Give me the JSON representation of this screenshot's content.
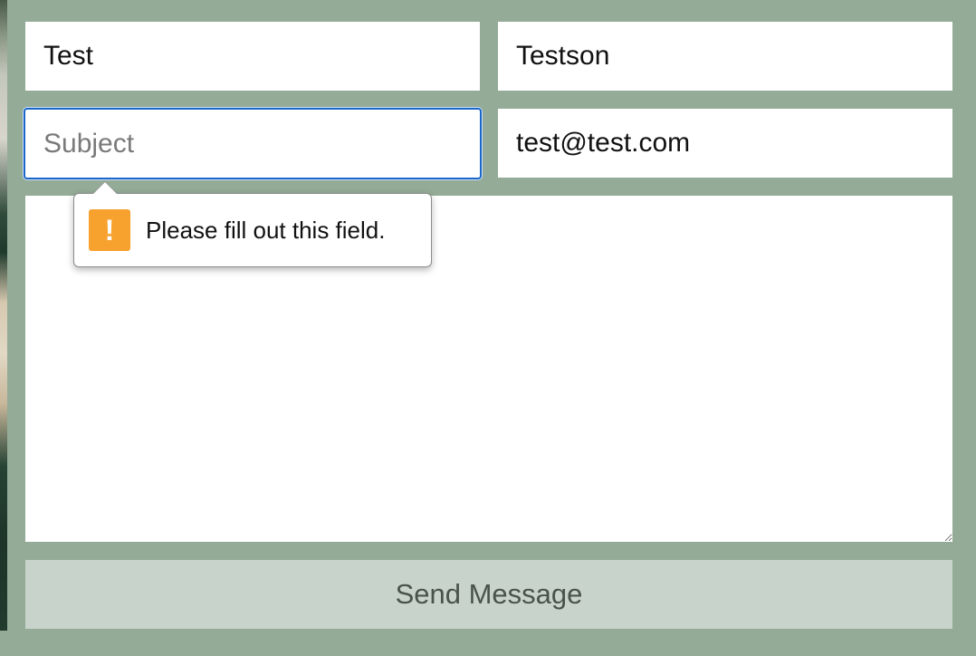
{
  "form": {
    "first_name": {
      "value": "Test"
    },
    "last_name": {
      "value": "Testson"
    },
    "subject": {
      "value": "",
      "placeholder": "Subject"
    },
    "email": {
      "value": "test@test.com"
    },
    "message": {
      "value": ""
    },
    "send_label": "Send Message"
  },
  "validation_tooltip": {
    "icon": "warning-icon",
    "icon_glyph": "!",
    "text": "Please fill out this field."
  },
  "colors": {
    "page_background": "#94ab98",
    "send_button_background": "#c8d4cb",
    "focus_border": "#1a66c9",
    "warning": "#f7a22f"
  }
}
